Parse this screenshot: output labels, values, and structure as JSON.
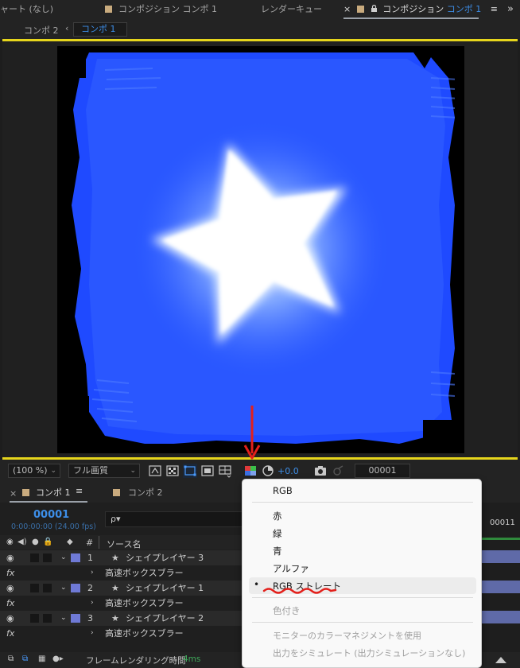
{
  "tabbar": {
    "left_tab": "ャート (なし)",
    "tab2": "コンポジション コンポ 1",
    "tab3": "レンダーキュー",
    "active_close": "×",
    "active_prefix": "コンポジション",
    "active_accent": "コンポ 1",
    "menu_icon": "≡",
    "overflow": "»"
  },
  "subbar": {
    "comp2": "コンポ 2",
    "arrow": "‹",
    "comp1": "コンポ 1"
  },
  "viewer_toolbar": {
    "zoom": "(100 %)",
    "quality": "フル画質",
    "exposure": "+0.0",
    "frame": "00001"
  },
  "timeline": {
    "tab1_close": "×",
    "tab1": "コンポ 1",
    "tab1_menu": "≡",
    "tab2": "コンポ 2",
    "timecode": "00001",
    "timecode_sub": "0:00:00:00 (24.00 fps)",
    "search_icon": "ρ▾",
    "hash_col": "#",
    "source_col": "ソース名",
    "ruler_label": "00011",
    "layers": [
      {
        "num": "1",
        "name": "シェイプレイヤー 3",
        "effect": "高速ボックスブラー"
      },
      {
        "num": "2",
        "name": "シェイプレイヤー 1",
        "effect": "高速ボックスブラー"
      },
      {
        "num": "3",
        "name": "シェイプレイヤー 2",
        "effect": "高速ボックスブラー"
      }
    ],
    "fx_label": "fx"
  },
  "status": {
    "label": "フレームレンダリング時間",
    "value": "4ms"
  },
  "menu": {
    "items": [
      {
        "label": "RGB"
      },
      {
        "label": "赤"
      },
      {
        "label": "緑"
      },
      {
        "label": "青"
      },
      {
        "label": "アルファ"
      },
      {
        "label": "RGB ストレート",
        "bullet": "•"
      },
      {
        "label": "色付き"
      },
      {
        "label": "モニターのカラーマネジメントを使用"
      },
      {
        "label": "出力をシミュレート (出力シミュレーションなし)"
      }
    ]
  },
  "colors": {
    "accent": "#3d8ee8",
    "highlight_yellow": "#e6d51c",
    "layer_label": "#6f7ad6",
    "annotation_red": "#e3201b",
    "glow_blue": "#0a40ff"
  }
}
